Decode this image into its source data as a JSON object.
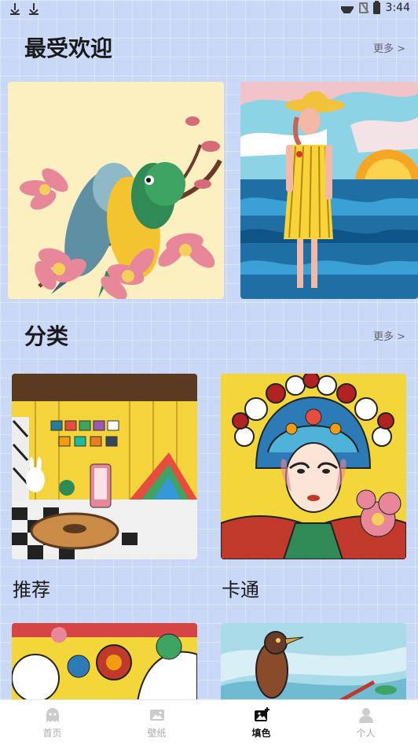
{
  "status_bar": {
    "time": "3:44"
  },
  "popular": {
    "title": "最受欢迎",
    "more": "更多 >"
  },
  "categories": {
    "title": "分类",
    "more": "更多 >",
    "items": [
      {
        "label": "推荐"
      },
      {
        "label": "卡通"
      }
    ]
  },
  "bottom_nav": {
    "items": [
      {
        "label": "首页",
        "icon": "home-icon",
        "active": false
      },
      {
        "label": "壁纸",
        "icon": "image-icon",
        "active": false
      },
      {
        "label": "填色",
        "icon": "fill-color-icon",
        "active": true
      },
      {
        "label": "个人",
        "icon": "person-icon",
        "active": false
      }
    ]
  },
  "colors": {
    "background": "#c9d8f7",
    "active_nav": "#111111",
    "inactive_nav": "#aaaaaa"
  }
}
